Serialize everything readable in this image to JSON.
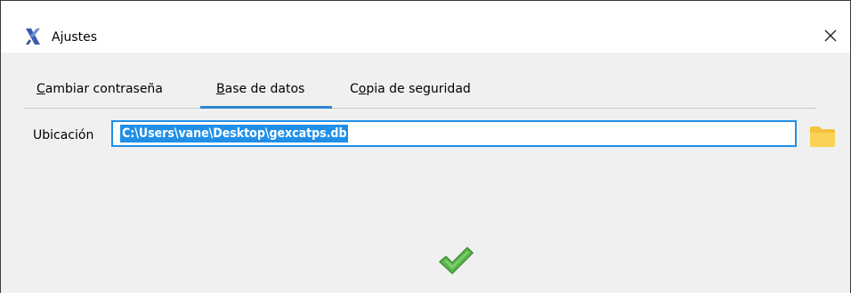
{
  "window": {
    "title": "Ajustes",
    "icons": {
      "app": "app-logo-icon",
      "close": "close-icon"
    }
  },
  "tabs": [
    {
      "label_underlined": "C",
      "label_rest": "ambiar contraseña",
      "active": false
    },
    {
      "label_underlined": "B",
      "label_rest": "ase de datos",
      "active": true
    },
    {
      "label_prefix": "C",
      "label_underlined": "o",
      "label_rest": "pia de seguridad",
      "active": false
    }
  ],
  "database": {
    "location_label": "Ubicación",
    "location_value": "C:\\Users\\vane\\Desktop\\gexcatps.db",
    "browse_icon": "folder-icon"
  },
  "actions": {
    "confirm_icon": "checkmark-icon"
  },
  "colors": {
    "accent": "#1f8fe8",
    "tab_active": "#2f86d3",
    "folder": "#f6c33a",
    "check": "#5ab84a"
  }
}
